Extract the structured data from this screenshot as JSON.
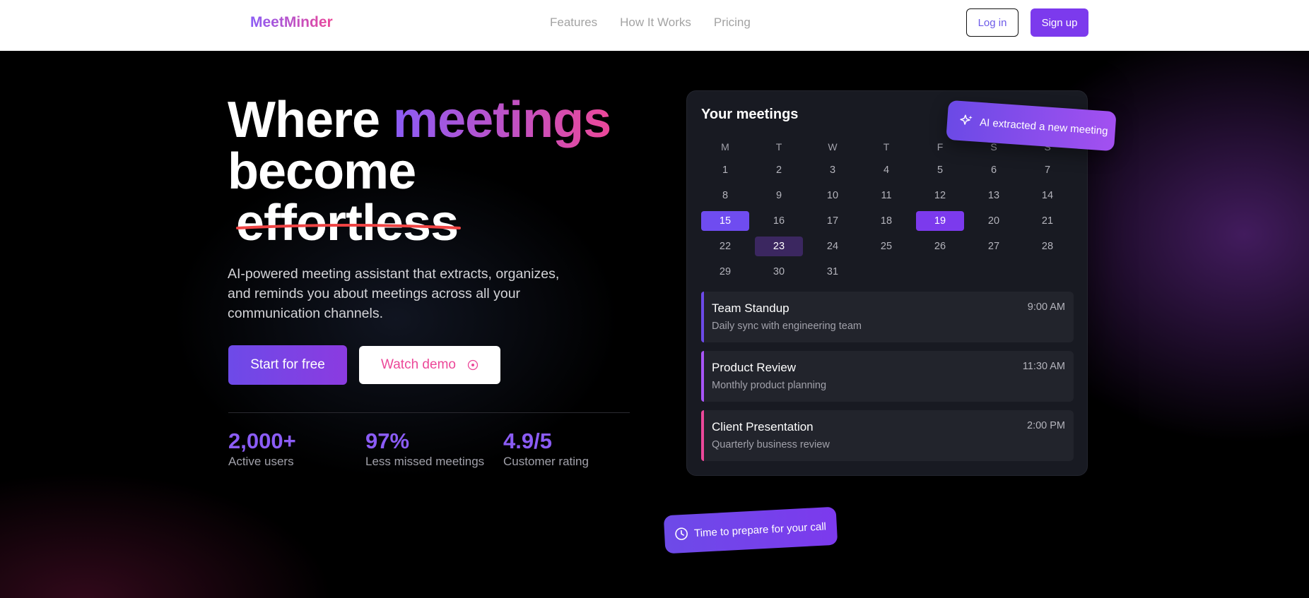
{
  "nav": {
    "brand": "MeetMinder",
    "links": [
      "Features",
      "How It Works",
      "Pricing"
    ],
    "login": "Log in",
    "signup": "Sign up"
  },
  "hero": {
    "headline_1": "Where ",
    "headline_highlight": "meetings",
    "headline_2": "become",
    "headline_strike": "effortless",
    "subtext": "AI-powered meeting assistant that extracts, organizes, and reminds you about meetings across all your communication channels.",
    "start_button": "Start for free",
    "demo_button": "Watch demo"
  },
  "stats": [
    {
      "value": "2,000+",
      "label": "Active users"
    },
    {
      "value": "97%",
      "label": "Less missed meetings"
    },
    {
      "value": "4.9/5",
      "label": "Customer rating"
    }
  ],
  "calendar": {
    "title": "Your meetings",
    "weekdays": [
      "M",
      "T",
      "W",
      "T",
      "F",
      "S",
      "S"
    ],
    "weeks": [
      [
        "1",
        "2",
        "3",
        "4",
        "5",
        "6",
        "7"
      ],
      [
        "8",
        "9",
        "10",
        "11",
        "12",
        "13",
        "14"
      ],
      [
        "15",
        "16",
        "17",
        "18",
        "19",
        "20",
        "21"
      ],
      [
        "22",
        "23",
        "24",
        "25",
        "26",
        "27",
        "28"
      ],
      [
        "29",
        "30",
        "31",
        "",
        "",
        "",
        ""
      ]
    ],
    "highlighted_days": [
      "15",
      "19"
    ],
    "today": "23"
  },
  "meetings": [
    {
      "title": "Team Standup",
      "desc": "Daily sync with engineering team",
      "time": "9:00 AM",
      "color": "#6d4ae8"
    },
    {
      "title": "Product Review",
      "desc": "Monthly product planning",
      "time": "11:30 AM",
      "color": "#a855f7"
    },
    {
      "title": "Client Presentation",
      "desc": "Quarterly business review",
      "time": "2:00 PM",
      "color": "#ec4899"
    }
  ],
  "toasts": {
    "ai": "AI extracted a new meeting",
    "reminder": "Time to prepare for your call"
  },
  "icons": {
    "sparkle": "sparkle-icon",
    "play": "play-circle-icon",
    "clock": "clock-icon"
  },
  "colors": {
    "accent": "#7c3aed",
    "pink": "#ec4899",
    "window_red": "#ef4444",
    "window_yellow": "#eab308",
    "window_green": "#22c55e"
  }
}
